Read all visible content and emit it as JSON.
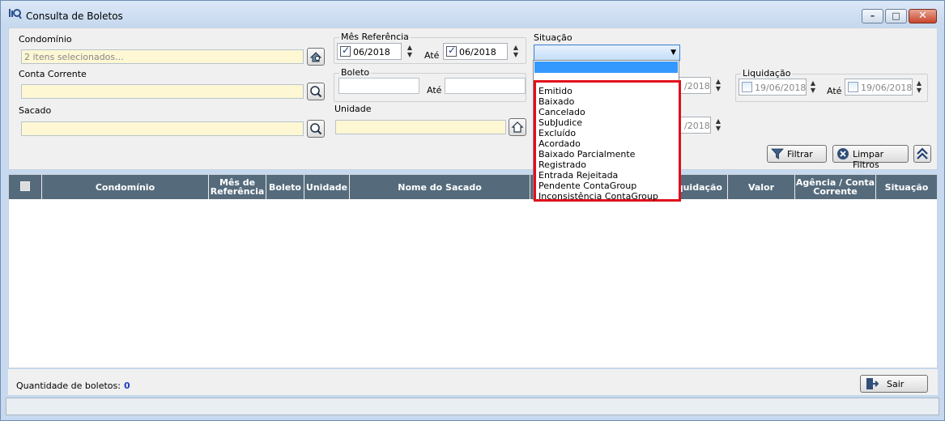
{
  "window": {
    "title": "Consulta de Boletos"
  },
  "filters": {
    "condominio": {
      "label": "Condomínio",
      "value": "2 itens selecionados..."
    },
    "conta_corrente": {
      "label": "Conta Corrente"
    },
    "sacado": {
      "label": "Sacado"
    },
    "mes_referencia": {
      "label": "Mês Referência",
      "from": "06/2018",
      "to": "06/2018",
      "ate": "Até"
    },
    "boleto": {
      "label": "Boleto",
      "ate": "Até"
    },
    "unidade": {
      "label": "Unidade"
    },
    "situacao": {
      "label": "Situação"
    },
    "emissao": {
      "from": "/2018",
      "to": "/2018"
    },
    "liquidacao": {
      "label": "Liquidação",
      "from": "19/06/2018",
      "to": "19/06/2018",
      "ate": "Até"
    },
    "filtrar_label": "Filtrar",
    "limpar_label": "Limpar Filtros"
  },
  "grid": {
    "columns": [
      "Condomínio",
      "Mês de Referência",
      "Boleto",
      "Unidade",
      "Nome do Sacado",
      "quidação",
      "Valor",
      "Agência / Conta Corrente",
      "Situação"
    ]
  },
  "situacao_options": [
    "Emitido",
    "Baixado",
    "Cancelado",
    "SubJudice",
    "Excluído",
    "Acordado",
    "Baixado Parcialmente",
    "Registrado",
    "Entrada Rejeitada",
    "Pendente ContaGroup",
    "Inconsistência ContaGroup"
  ],
  "footer": {
    "quantidade_label": "Quantidade de boletos:",
    "quantidade_value": "0",
    "sair_label": "Sair"
  },
  "colors": {
    "highlight": "#e0101c",
    "header": "#556b7c",
    "selection": "#3399ff"
  },
  "icons": [
    "report-search-icon",
    "house-search-icon",
    "magnifier-icon",
    "house-icon",
    "funnel-icon",
    "clear-icon",
    "collapse-icon",
    "exit-icon"
  ]
}
